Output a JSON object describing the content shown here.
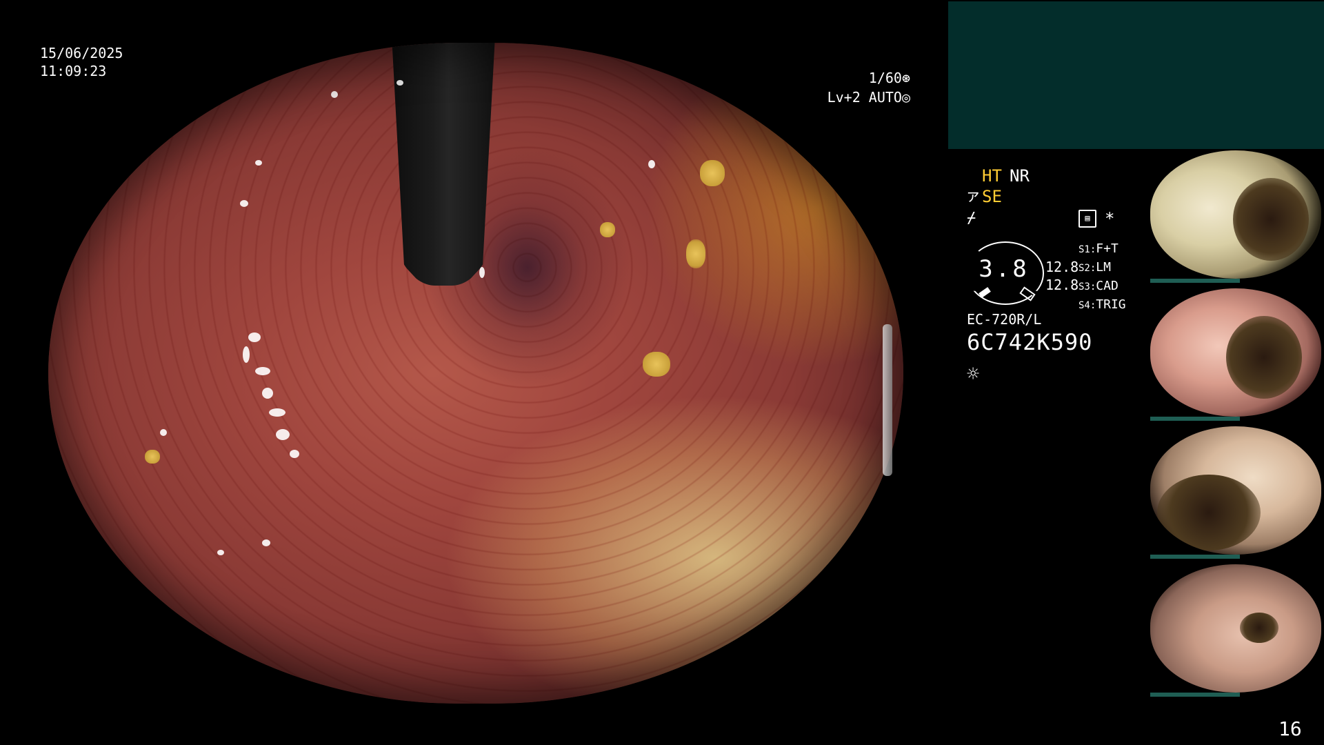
{
  "overlay": {
    "date": "15/06/2025",
    "time": "11:09:23",
    "shutter": "1/60⊛",
    "level": "Lv+2 AUTO◎"
  },
  "info_panel": {
    "ht": "HT",
    "nr": "NR",
    "se": "SE",
    "se_icon": "ァ",
    "wave_icon": "⌿",
    "doc_icon": "▤",
    "star_icon": "*",
    "gauge_value": "3.8",
    "gauge_right_1": "12.8",
    "gauge_right_2": "12.8",
    "settings": [
      {
        "key": "S1:",
        "value": "F+T"
      },
      {
        "key": "S2:",
        "value": "LM"
      },
      {
        "key": "S3:",
        "value": "CAD"
      },
      {
        "key": "S4:",
        "value": "TRIG"
      }
    ],
    "scope_model": "EC-720R/L",
    "serial": "6C742K590",
    "sun_icon": "☼"
  },
  "page_number": "16"
}
